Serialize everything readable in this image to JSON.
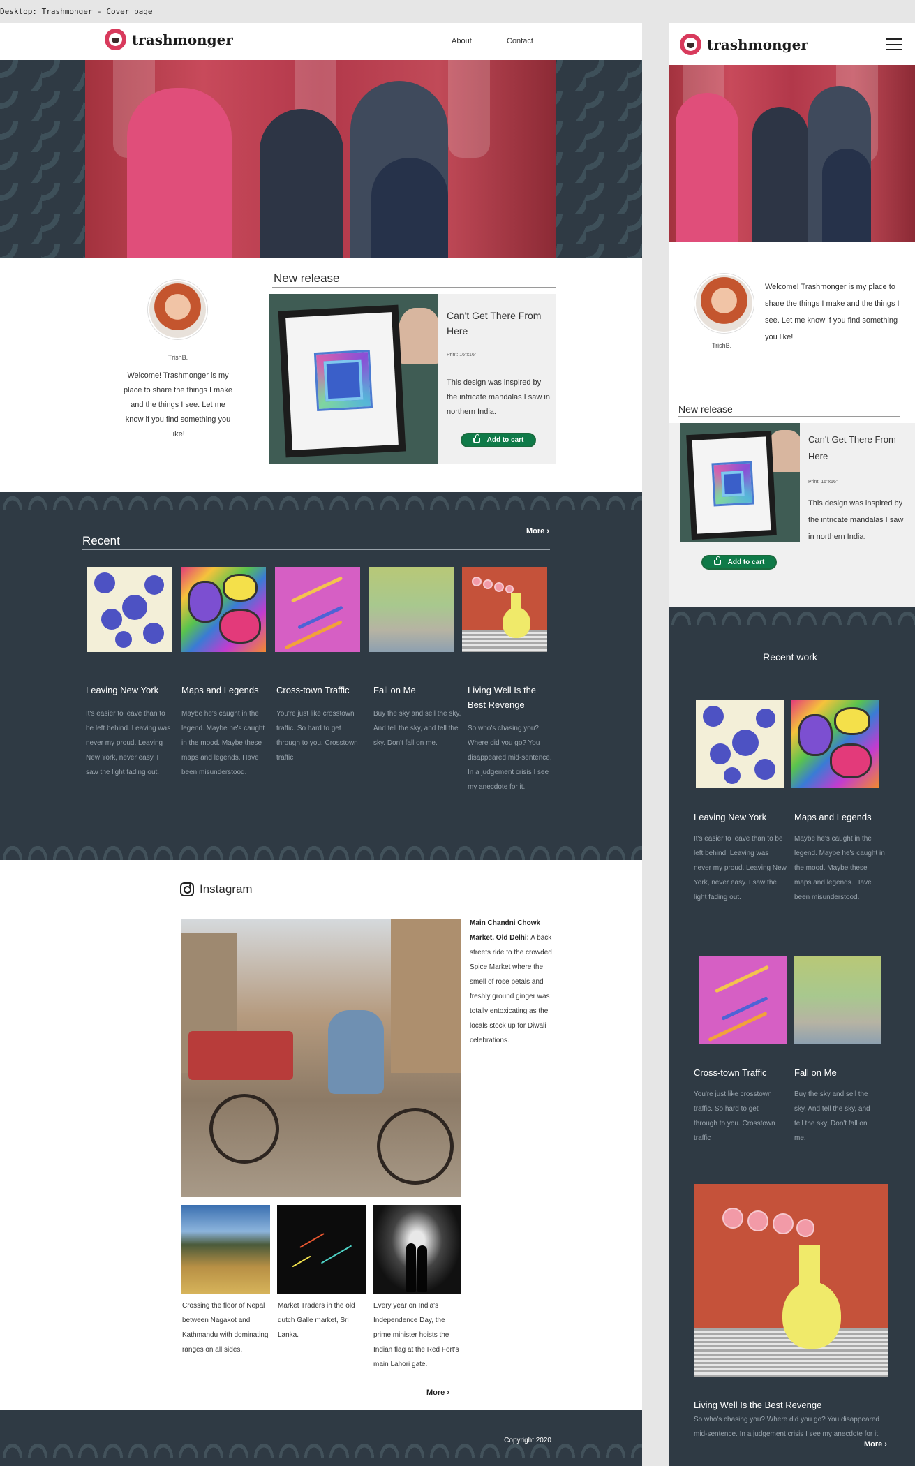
{
  "frame_label": "Desktop: Trashmonger - Cover page",
  "brand": {
    "name": "trashmonger",
    "logo_icon": "face-logo-icon"
  },
  "nav": {
    "links": [
      "About",
      "Contact"
    ]
  },
  "author": {
    "name": "TrishB.",
    "welcome": "Welcome! Trashmonger is my place to share the things I make and the things I see. Let me know if you find something you like!"
  },
  "new_release": {
    "heading": "New release",
    "title": "Can't Get There From Here",
    "print": "Print: 16\"x16\"",
    "description": "This design was inspired by the intricate mandalas I saw in northern India.",
    "cart_label": "Add to cart"
  },
  "recent": {
    "heading": "Recent",
    "mobile_heading": "Recent work",
    "more_label": "More ›",
    "works": [
      {
        "title": "Leaving New York",
        "desc": "It's easier to leave than to be left behind. Leaving was never my proud. Leaving New York, never easy. I saw the light fading out."
      },
      {
        "title": "Maps and Legends",
        "desc": "Maybe he's caught in the legend. Maybe he's caught in the mood. Maybe these maps and legends. Have been misunderstood."
      },
      {
        "title": "Cross-town Traffic",
        "desc": "You're just like crosstown traffic. So hard to get through to you. Crosstown traffic"
      },
      {
        "title": "Fall on Me",
        "desc": "Buy the sky and sell the sky. And tell the sky, and tell the sky. Don't fall on me."
      },
      {
        "title": "Living Well Is the Best Revenge",
        "desc": "So who's chasing you? Where did you go? You disappeared mid-sentence. In a judgement crisis I see my anecdote for it."
      }
    ]
  },
  "instagram": {
    "heading": "Instagram",
    "main_caption_bold": "Main Chandni Chowk Market, Old Delhi:",
    "main_caption": " A back streets ride to the crowded Spice Market where the smell of rose petals and freshly ground ginger was totally entoxicating as the locals stock up for Diwali celebrations.",
    "small": [
      {
        "caption": "Crossing the floor of Nepal between Nagakot and Kathmandu with dominating ranges on all sides."
      },
      {
        "caption": "Market Traders in the old dutch Galle market, Sri Lanka."
      },
      {
        "caption": "Every year on India's Independence Day, the prime minister hoists the Indian flag at the Red Fort's main Lahori gate."
      }
    ],
    "more_label": "More ›"
  },
  "footer": {
    "copyright": "Copyright 2020"
  },
  "colors": {
    "dark_band": "#2f3a44",
    "cart_green": "#0f7a48",
    "brand_red": "#d83a5c"
  }
}
